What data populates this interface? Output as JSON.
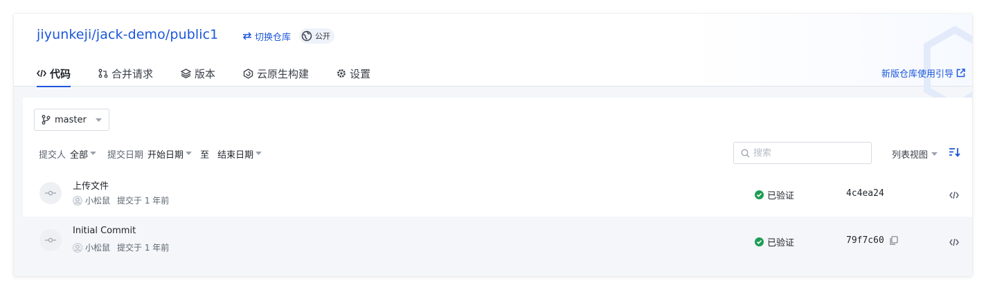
{
  "repo": {
    "owner": "jiyunkeji",
    "group": "jack-demo",
    "name": "public1",
    "sep": "/",
    "switch_label": "切换仓库",
    "visibility": "公开"
  },
  "tabs": [
    {
      "label": "代码",
      "icon": "code-icon",
      "active": true
    },
    {
      "label": "合并请求",
      "icon": "merge-request-icon",
      "active": false
    },
    {
      "label": "版本",
      "icon": "layers-icon",
      "active": false
    },
    {
      "label": "云原生构建",
      "icon": "build-icon",
      "active": false
    },
    {
      "label": "设置",
      "icon": "gear-icon",
      "active": false
    }
  ],
  "guide_label": "新版仓库使用引导",
  "branch": "master",
  "filters": {
    "committer_label": "提交人",
    "committer_value": "全部",
    "date_label": "提交日期",
    "start_date": "开始日期",
    "to": "至",
    "end_date": "结束日期"
  },
  "search": {
    "placeholder": "搜索"
  },
  "view_mode": "列表视图",
  "commits": [
    {
      "title": "上传文件",
      "author": "小松鼠",
      "time": "提交于 1 年前",
      "status": "已验证",
      "sha": "4c4ea24"
    },
    {
      "title": "Initial Commit",
      "author": "小松鼠",
      "time": "提交于 1 年前",
      "status": "已验证",
      "sha": "79f7c60"
    }
  ],
  "colors": {
    "accent": "#1a56db",
    "verified": "#1f9d55"
  }
}
